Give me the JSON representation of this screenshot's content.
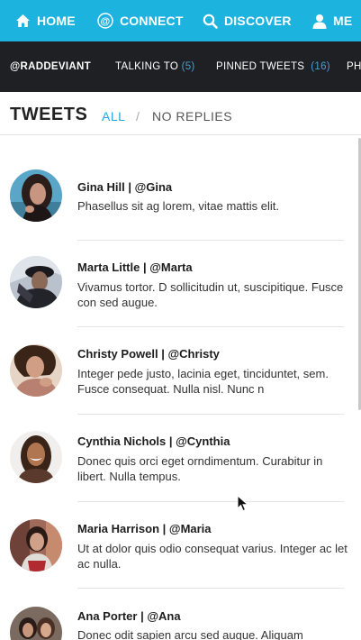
{
  "topnav": {
    "home": "HOME",
    "connect": "CONNECT",
    "discover": "DISCOVER",
    "me": "ME",
    "icons": [
      "home-icon",
      "at-sign-icon",
      "search-icon",
      "person-icon"
    ],
    "background": "#1cb3df"
  },
  "subnav": {
    "handle": "@RADDEVIANT",
    "talking_label": "TALKING TO",
    "talking_count": "(5)",
    "pinned_label": "PINNED TWEETS",
    "pinned_count": "(16)",
    "more_label": "PH",
    "background": "#1f2024"
  },
  "tweets_header": {
    "title": "TWEETS",
    "filter_all": "ALL",
    "separator": "/",
    "filter_no_replies": "NO REPLIES",
    "accent": "#28a8d8"
  },
  "tweets": [
    {
      "author": "Gina Hill | @Gina",
      "text": "Phasellus sit ag lorem, vitae mattis elit."
    },
    {
      "author": "Marta Little | @Marta",
      "text": "Vivamus tortor. D sollicitudin ut, suscipitique. Fusce con sed augue."
    },
    {
      "author": "Christy Powell | @Christy",
      "text": "Integer pede justo, lacinia eget, tinciduntet, sem. Fusce consequat. Nulla nisl. Nunc n"
    },
    {
      "author": "Cynthia Nichols | @Cynthia",
      "text": "Donec quis orci eget orndimentum. Curabitur in libert. Nulla tempus."
    },
    {
      "author": "Maria Harrison | @Maria",
      "text": "Ut at dolor quis odio consequat varius. Integer ac let ac nulla."
    },
    {
      "author": "Ana Porter | @Ana",
      "text": "Donec odit sapien arcu sed augue. Aliquam"
    }
  ]
}
